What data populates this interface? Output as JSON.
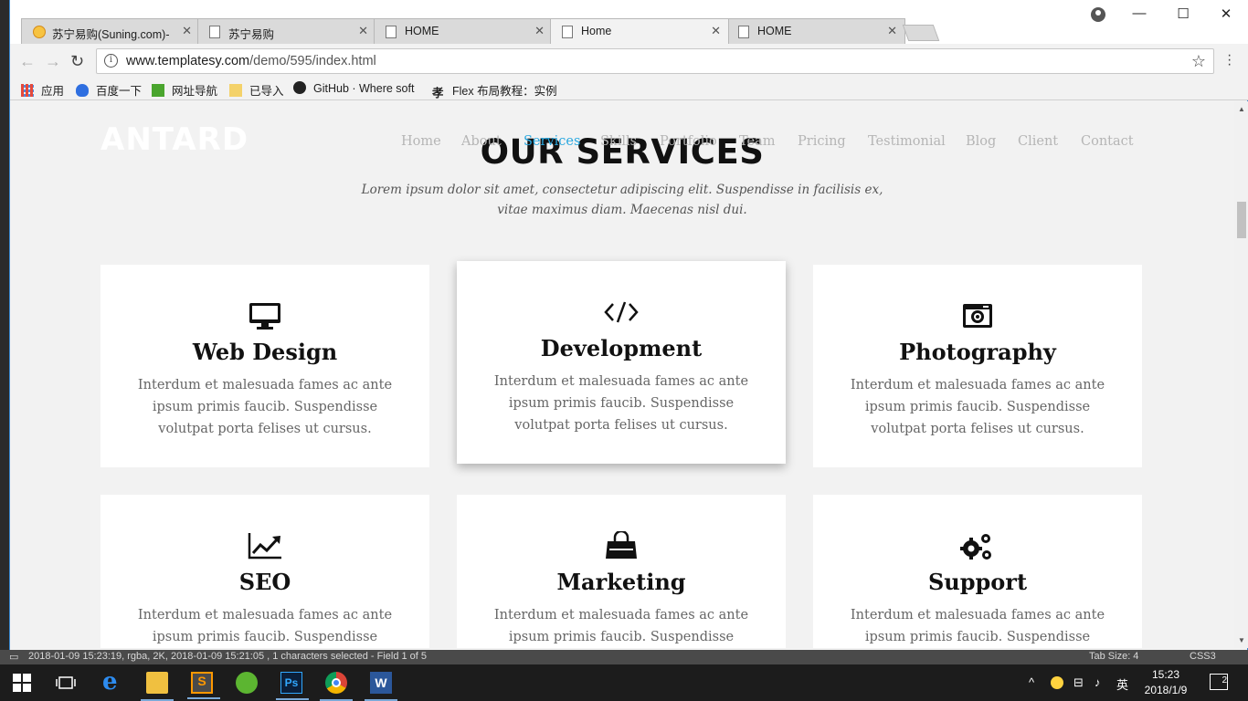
{
  "browser": {
    "tabs": [
      {
        "title": "苏宁易购(Suning.com)-",
        "icon": "suning-icon",
        "active": false
      },
      {
        "title": "苏宁易购",
        "icon": "page-icon",
        "active": false
      },
      {
        "title": "HOME",
        "icon": "page-icon",
        "active": false
      },
      {
        "title": "Home",
        "icon": "page-icon",
        "active": true
      },
      {
        "title": "HOME",
        "icon": "page-icon",
        "active": false
      }
    ],
    "tab_close": "✕",
    "window_controls": {
      "minimize": "—",
      "maximize": "☐",
      "close": "✕"
    },
    "url_host": "www.templatesy.com",
    "url_path": "/demo/595/index.html",
    "bookmarks": [
      "应用",
      "百度一下",
      "网址导航",
      "已导入",
      "GitHub · Where soft",
      "Flex 布局教程：实例"
    ]
  },
  "site": {
    "logo": "ANTARD",
    "nav": [
      "Home",
      "About",
      "Services",
      "Skills",
      "Portfolio",
      "Team",
      "Pricing",
      "Testimonial",
      "Blog",
      "Client",
      "Contact"
    ],
    "active_nav": "Services",
    "accent_color": "#29a8e0",
    "section_title": "OUR SERVICES",
    "section_subtitle": "Lorem ipsum dolor sit amet, consectetur adipiscing elit. Suspendisse in facilisis ex, vitae maximus diam. Maecenas nisl dui.",
    "services": [
      {
        "title": "Web Design",
        "icon": "desktop-icon",
        "text": "Interdum et malesuada fames ac ante ipsum primis faucib. Suspendisse volutpat porta felises ut cursus."
      },
      {
        "title": "Development",
        "icon": "code-icon",
        "text": "Interdum et malesuada fames ac ante ipsum primis faucib. Suspendisse volutpat porta felises ut cursus."
      },
      {
        "title": "Photography",
        "icon": "camera-icon",
        "text": "Interdum et malesuada fames ac ante ipsum primis faucib. Suspendisse volutpat porta felises ut cursus."
      },
      {
        "title": "SEO",
        "icon": "line-chart-icon",
        "text": "Interdum et malesuada fames ac ante ipsum primis faucib. Suspendisse volutpat porta felises ut cursus."
      },
      {
        "title": "Marketing",
        "icon": "shopping-bag-icon",
        "text": "Interdum et malesuada fames ac ante ipsum primis faucib. Suspendisse volutpat porta felises ut cursus."
      },
      {
        "title": "Support",
        "icon": "gears-icon",
        "text": "Interdum et malesuada fames ac ante ipsum primis faucib. Suspendisse volutpat porta felises ut cursus."
      }
    ]
  },
  "statusbar": {
    "left": "2018-01-09 15:23:19, rgba, 2K, 2018-01-09 15:21:05 , 1 characters selected - Field 1 of 5",
    "tab_size": "Tab Size: 4",
    "syntax": "CSS3"
  },
  "taskbar": {
    "time": "15:23",
    "date": "2018/1/9",
    "ime": "英",
    "notification_count": "2",
    "tray_chevron": "^"
  }
}
